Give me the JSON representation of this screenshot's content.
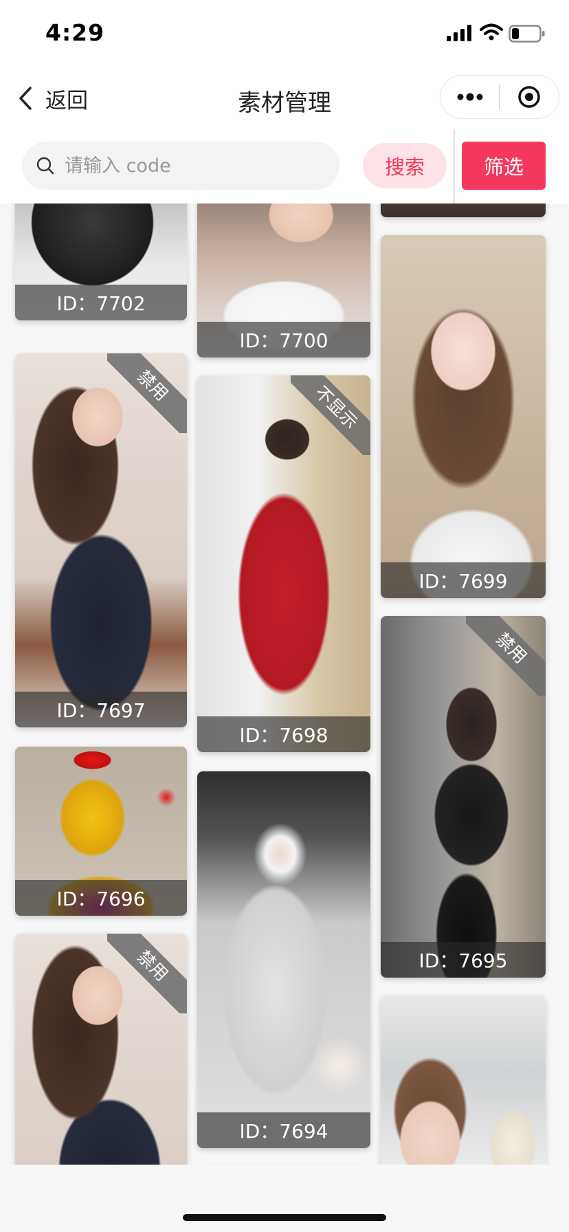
{
  "status_bar": {
    "time": "4:29"
  },
  "nav": {
    "back_label": "返回",
    "title": "素材管理",
    "more_icon": "more-dots-icon",
    "close_icon": "target-circle-icon"
  },
  "search": {
    "placeholder": "请输入 code",
    "value": "",
    "search_label": "搜索",
    "filter_label": "筛选"
  },
  "colors": {
    "accent": "#f4385e",
    "accent_soft": "#fde3e8",
    "badge_bg": "#6e6e6e"
  },
  "cards": [
    {
      "id_text": "ID：7702",
      "badge": ""
    },
    {
      "id_text": "ID：7700",
      "badge": ""
    },
    {
      "id_text": "ID：7699",
      "badge": ""
    },
    {
      "id_text": "ID：7697",
      "badge": "禁用"
    },
    {
      "id_text": "ID：7698",
      "badge": "不显示"
    },
    {
      "id_text": "ID：7695",
      "badge": "禁用"
    },
    {
      "id_text": "ID：7696",
      "badge": ""
    },
    {
      "id_text": "ID：7694",
      "badge": ""
    },
    {
      "id_text": "",
      "badge": "禁用"
    },
    {
      "id_text": "",
      "badge": ""
    },
    {
      "id_text": "",
      "badge": ""
    }
  ]
}
